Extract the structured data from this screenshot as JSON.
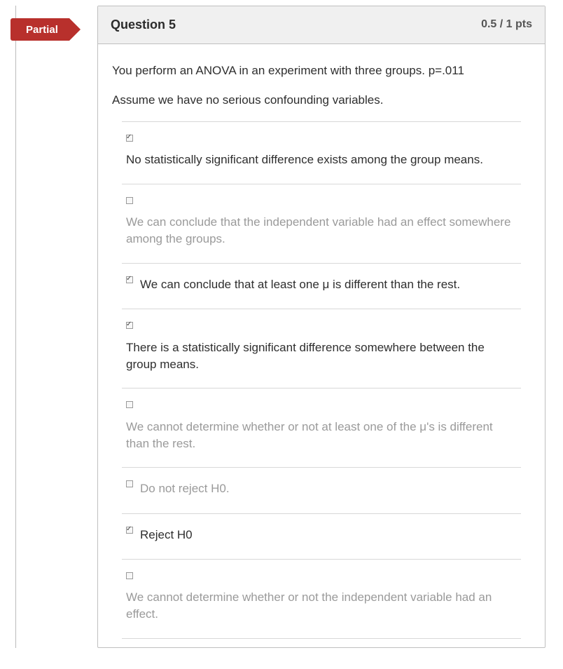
{
  "badge_label": "Partial",
  "question": {
    "title": "Question 5",
    "points": "0.5 / 1 pts",
    "prompt_line1": "You perform an ANOVA in an experiment with three groups.  p=.011",
    "prompt_line2": "Assume we have no serious confounding variables."
  },
  "answers": [
    {
      "checked": true,
      "dim": false,
      "layout": "block",
      "text": "No statistically significant difference exists among the group means."
    },
    {
      "checked": false,
      "dim": true,
      "layout": "block",
      "text": "We can conclude that the independent variable had an effect somewhere among the groups."
    },
    {
      "checked": true,
      "dim": false,
      "layout": "inline",
      "text": "We can conclude that at least one μ is different than the rest."
    },
    {
      "checked": true,
      "dim": false,
      "layout": "block",
      "text": "There is a statistically significant difference somewhere between the group means."
    },
    {
      "checked": false,
      "dim": true,
      "layout": "block",
      "text": "We cannot determine whether or not at least one of the μ's is different than the rest."
    },
    {
      "checked": false,
      "dim": true,
      "layout": "inline",
      "text": "Do not reject H0."
    },
    {
      "checked": true,
      "dim": false,
      "layout": "inline",
      "text": "Reject H0"
    },
    {
      "checked": false,
      "dim": true,
      "layout": "block",
      "text": "We cannot determine whether or not the independent variable had an effect."
    }
  ]
}
